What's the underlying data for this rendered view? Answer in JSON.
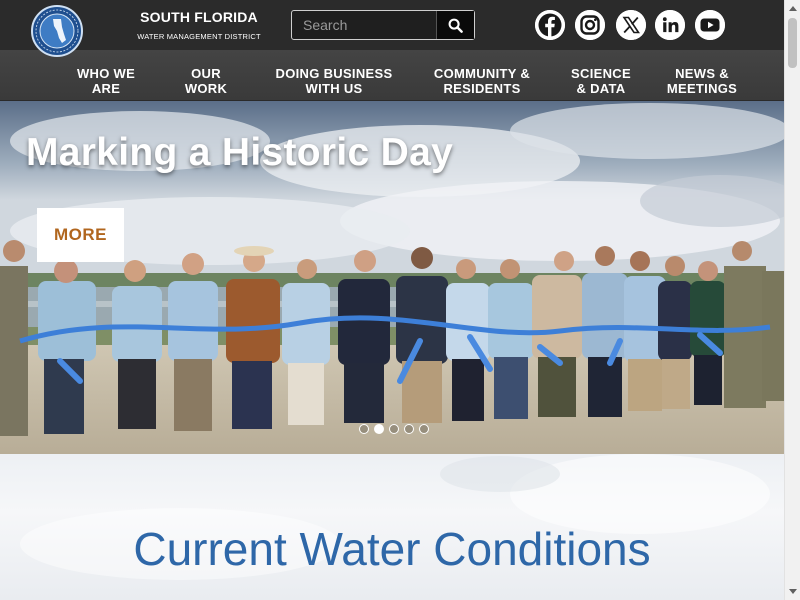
{
  "header": {
    "brand_title": "SOUTH FLORIDA",
    "brand_subtitle": "WATER MANAGEMENT DISTRICT",
    "logo_icon": "district-seal-icon",
    "search": {
      "placeholder": "Search",
      "button_icon": "search-icon"
    },
    "social": [
      {
        "name": "facebook",
        "icon": "facebook-icon"
      },
      {
        "name": "instagram",
        "icon": "instagram-icon"
      },
      {
        "name": "x",
        "icon": "x-icon"
      },
      {
        "name": "linkedin",
        "icon": "linkedin-icon"
      },
      {
        "name": "youtube",
        "icon": "youtube-icon"
      }
    ]
  },
  "nav": {
    "items": [
      {
        "label": "WHO WE\nARE"
      },
      {
        "label": "OUR\nWORK"
      },
      {
        "label": "DOING BUSINESS\nWITH US"
      },
      {
        "label": "COMMUNITY &\nRESIDENTS"
      },
      {
        "label": "SCIENCE\n& DATA"
      },
      {
        "label": "NEWS &\nMEETINGS"
      }
    ]
  },
  "hero": {
    "title": "Marking a Historic Day",
    "more_label": "MORE",
    "slide_count": 5,
    "active_slide": 2
  },
  "conditions": {
    "title": "Current Water Conditions"
  },
  "colors": {
    "topbar": "#2b2b2b",
    "nav": "#3f3f3f",
    "more_text": "#b1661e",
    "section_title": "#2e67a8"
  }
}
